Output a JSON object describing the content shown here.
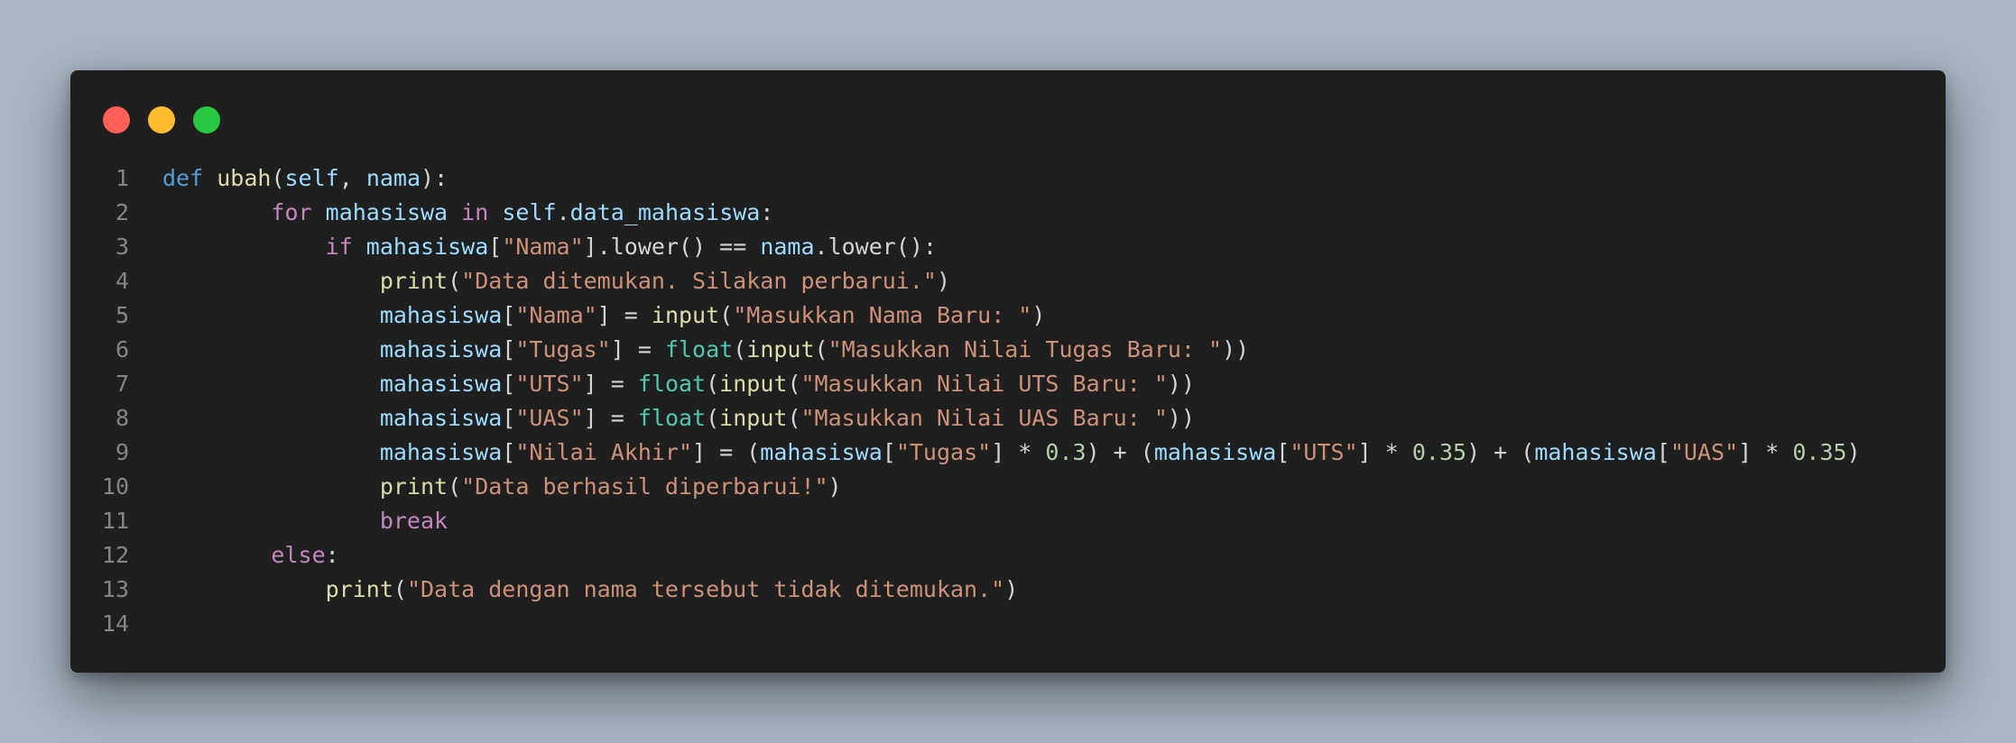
{
  "window": {
    "controls": [
      "close",
      "minimize",
      "maximize"
    ],
    "colors": {
      "close": "#ff5f57",
      "minimize": "#febc2e",
      "maximize": "#28c840",
      "background": "#1f1f1f"
    }
  },
  "code": {
    "language": "python",
    "lines": [
      {
        "n": "1",
        "indent": "",
        "tokens": [
          [
            "k",
            "def"
          ],
          [
            "p",
            " "
          ],
          [
            "f",
            "ubah"
          ],
          [
            "p",
            "("
          ],
          [
            "v",
            "self"
          ],
          [
            "p",
            ", "
          ],
          [
            "v",
            "nama"
          ],
          [
            "p",
            "):"
          ]
        ]
      },
      {
        "n": "2",
        "indent": "        ",
        "tokens": [
          [
            "c",
            "for"
          ],
          [
            "p",
            " "
          ],
          [
            "v",
            "mahasiswa"
          ],
          [
            "p",
            " "
          ],
          [
            "c",
            "in"
          ],
          [
            "p",
            " "
          ],
          [
            "v",
            "self"
          ],
          [
            "p",
            "."
          ],
          [
            "v",
            "data_mahasiswa"
          ],
          [
            "p",
            ":"
          ]
        ]
      },
      {
        "n": "3",
        "indent": "            ",
        "tokens": [
          [
            "c",
            "if"
          ],
          [
            "p",
            " "
          ],
          [
            "v",
            "mahasiswa"
          ],
          [
            "p",
            "["
          ],
          [
            "s",
            "\"Nama\""
          ],
          [
            "p",
            "].lower() == "
          ],
          [
            "v",
            "nama"
          ],
          [
            "p",
            ".lower():"
          ]
        ]
      },
      {
        "n": "4",
        "indent": "                ",
        "tokens": [
          [
            "f",
            "print"
          ],
          [
            "p",
            "("
          ],
          [
            "s",
            "\"Data ditemukan. Silakan perbarui.\""
          ],
          [
            "p",
            ")"
          ]
        ]
      },
      {
        "n": "5",
        "indent": "                ",
        "tokens": [
          [
            "v",
            "mahasiswa"
          ],
          [
            "p",
            "["
          ],
          [
            "s",
            "\"Nama\""
          ],
          [
            "p",
            "] = "
          ],
          [
            "f",
            "input"
          ],
          [
            "p",
            "("
          ],
          [
            "s",
            "\"Masukkan Nama Baru: \""
          ],
          [
            "p",
            ")"
          ]
        ]
      },
      {
        "n": "6",
        "indent": "                ",
        "tokens": [
          [
            "v",
            "mahasiswa"
          ],
          [
            "p",
            "["
          ],
          [
            "s",
            "\"Tugas\""
          ],
          [
            "p",
            "] = "
          ],
          [
            "t",
            "float"
          ],
          [
            "p",
            "("
          ],
          [
            "f",
            "input"
          ],
          [
            "p",
            "("
          ],
          [
            "s",
            "\"Masukkan Nilai Tugas Baru: \""
          ],
          [
            "p",
            "))"
          ]
        ]
      },
      {
        "n": "7",
        "indent": "                ",
        "tokens": [
          [
            "v",
            "mahasiswa"
          ],
          [
            "p",
            "["
          ],
          [
            "s",
            "\"UTS\""
          ],
          [
            "p",
            "] = "
          ],
          [
            "t",
            "float"
          ],
          [
            "p",
            "("
          ],
          [
            "f",
            "input"
          ],
          [
            "p",
            "("
          ],
          [
            "s",
            "\"Masukkan Nilai UTS Baru: \""
          ],
          [
            "p",
            "))"
          ]
        ]
      },
      {
        "n": "8",
        "indent": "                ",
        "tokens": [
          [
            "v",
            "mahasiswa"
          ],
          [
            "p",
            "["
          ],
          [
            "s",
            "\"UAS\""
          ],
          [
            "p",
            "] = "
          ],
          [
            "t",
            "float"
          ],
          [
            "p",
            "("
          ],
          [
            "f",
            "input"
          ],
          [
            "p",
            "("
          ],
          [
            "s",
            "\"Masukkan Nilai UAS Baru: \""
          ],
          [
            "p",
            "))"
          ]
        ]
      },
      {
        "n": "9",
        "indent": "                ",
        "tokens": [
          [
            "v",
            "mahasiswa"
          ],
          [
            "p",
            "["
          ],
          [
            "s",
            "\"Nilai Akhir\""
          ],
          [
            "p",
            "] = ("
          ],
          [
            "v",
            "mahasiswa"
          ],
          [
            "p",
            "["
          ],
          [
            "s",
            "\"Tugas\""
          ],
          [
            "p",
            "] * "
          ],
          [
            "n",
            "0.3"
          ],
          [
            "p",
            ") + ("
          ],
          [
            "v",
            "mahasiswa"
          ],
          [
            "p",
            "["
          ],
          [
            "s",
            "\"UTS\""
          ],
          [
            "p",
            "] * "
          ],
          [
            "n",
            "0.35"
          ],
          [
            "p",
            ") + ("
          ],
          [
            "v",
            "mahasiswa"
          ],
          [
            "p",
            "["
          ],
          [
            "s",
            "\"UAS\""
          ],
          [
            "p",
            "] * "
          ],
          [
            "n",
            "0.35"
          ],
          [
            "p",
            ")"
          ]
        ]
      },
      {
        "n": "10",
        "indent": "                ",
        "tokens": [
          [
            "f",
            "print"
          ],
          [
            "p",
            "("
          ],
          [
            "s",
            "\"Data berhasil diperbarui!\""
          ],
          [
            "p",
            ")"
          ]
        ]
      },
      {
        "n": "11",
        "indent": "                ",
        "tokens": [
          [
            "c",
            "break"
          ]
        ]
      },
      {
        "n": "12",
        "indent": "        ",
        "tokens": [
          [
            "c",
            "else"
          ],
          [
            "p",
            ":"
          ]
        ]
      },
      {
        "n": "13",
        "indent": "            ",
        "tokens": [
          [
            "f",
            "print"
          ],
          [
            "p",
            "("
          ],
          [
            "s",
            "\"Data dengan nama tersebut tidak ditemukan.\""
          ],
          [
            "p",
            ")"
          ]
        ]
      },
      {
        "n": "14",
        "indent": "",
        "tokens": []
      }
    ]
  }
}
